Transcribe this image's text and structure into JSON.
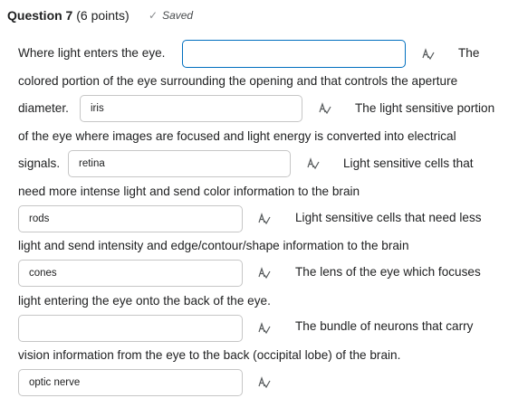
{
  "question": {
    "title": "Question 7",
    "points": "(6 points)",
    "status": "Saved",
    "status_icon": "check-icon"
  },
  "text": {
    "t1": "Where light enters the eye.",
    "t2": "The",
    "t3": "colored portion of the eye surrounding the opening and that controls the aperture",
    "t4": "diameter.",
    "t5": "The light sensitive portion",
    "t6": "of the eye where images are focused and light energy is converted into electrical",
    "t7": "signals.",
    "t8": "Light sensitive cells that",
    "t9": "need more intense light and send color information to the brain",
    "t10": "Light sensitive cells that need less",
    "t11": "light and send intensity and edge/contour/shape information to the brain",
    "t12": "The lens of the eye which focuses",
    "t13": "light entering the eye onto the back of the eye.",
    "t14": "The bundle of neurons that carry",
    "t15": "vision information from the eye to the back (occipital lobe) of the brain."
  },
  "answers": {
    "a1": "",
    "a2": "iris",
    "a3": "retina",
    "a4": "rods",
    "a5": "cones",
    "a6": "",
    "a7": "optic nerve"
  },
  "icons": {
    "spellcheck": "spellcheck-icon"
  },
  "colors": {
    "focus_border": "#006fbf",
    "input_border": "#c6c6c6",
    "text": "#202122"
  }
}
